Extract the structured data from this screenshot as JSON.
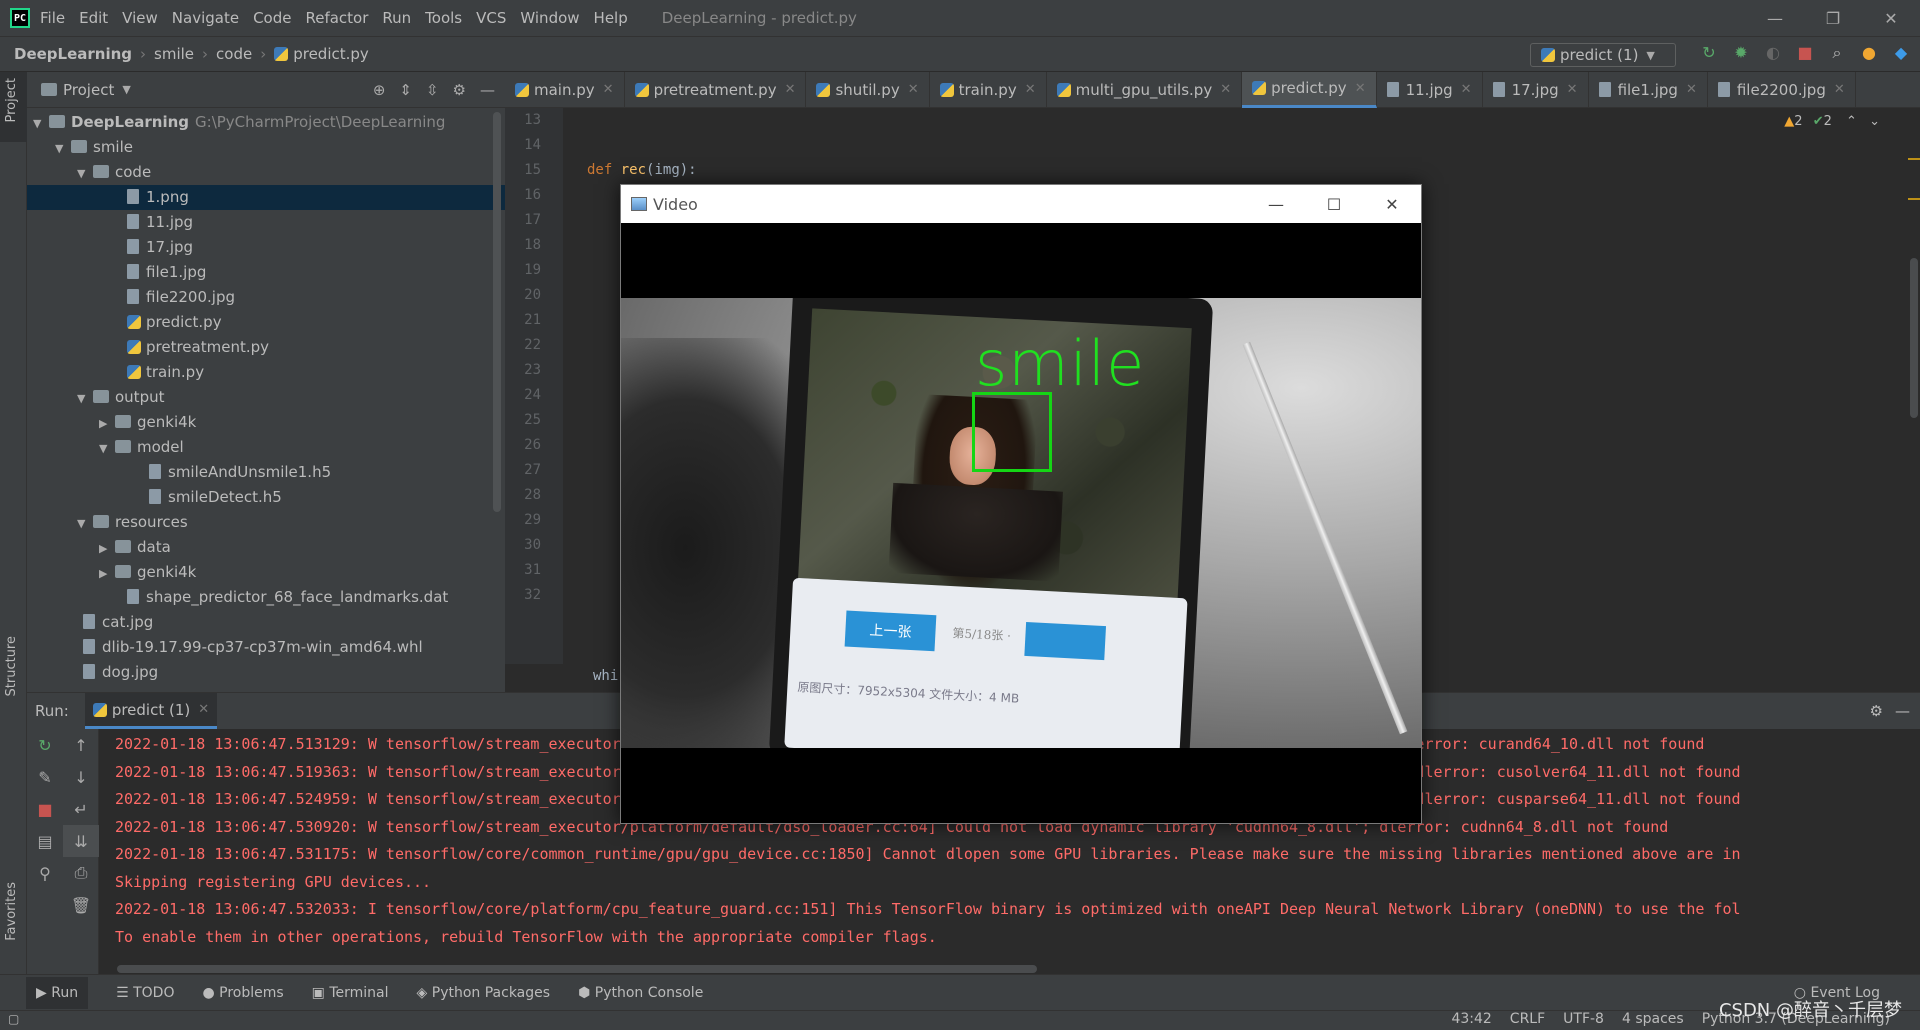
{
  "menubar": {
    "items": [
      "File",
      "Edit",
      "View",
      "Navigate",
      "Code",
      "Refactor",
      "Run",
      "Tools",
      "VCS",
      "Window",
      "Help"
    ],
    "window_title": "DeepLearning - predict.py"
  },
  "navbar": {
    "crumbs": [
      "DeepLearning",
      "smile",
      "code",
      "predict.py"
    ],
    "run_config": "predict (1)"
  },
  "project_panel": {
    "title": "Project",
    "tree": [
      {
        "label": "DeepLearning",
        "path": "G:\\PyCharmProject\\DeepLearning"
      },
      {
        "label": "smile"
      },
      {
        "label": "code"
      },
      {
        "label": "1.png"
      },
      {
        "label": "11.jpg"
      },
      {
        "label": "17.jpg"
      },
      {
        "label": "file1.jpg"
      },
      {
        "label": "file2200.jpg"
      },
      {
        "label": "predict.py"
      },
      {
        "label": "pretreatment.py"
      },
      {
        "label": "train.py"
      },
      {
        "label": "output"
      },
      {
        "label": "genki4k"
      },
      {
        "label": "model"
      },
      {
        "label": "smileAndUnsmile1.h5"
      },
      {
        "label": "smileDetect.h5"
      },
      {
        "label": "resources"
      },
      {
        "label": "data"
      },
      {
        "label": "genki4k"
      },
      {
        "label": "shape_predictor_68_face_landmarks.dat"
      },
      {
        "label": "cat.jpg"
      },
      {
        "label": "dlib-19.17.99-cp37-cp37m-win_amd64.whl"
      },
      {
        "label": "dog.jpg"
      }
    ]
  },
  "editor": {
    "tabs": [
      "main.py",
      "pretreatment.py",
      "shutil.py",
      "train.py",
      "multi_gpu_utils.py",
      "predict.py",
      "11.jpg",
      "17.jpg",
      "file1.jpg",
      "file2200.jpg"
    ],
    "active_tab": "predict.py",
    "line_numbers": [
      "13",
      "14",
      "15",
      "16",
      "17",
      "18",
      "19",
      "20",
      "21",
      "22",
      "23",
      "24",
      "25",
      "26",
      "27",
      "28",
      "29",
      "30",
      "31",
      "32"
    ],
    "code_line_15_kw": "def",
    "code_line_15_fn": "rec",
    "code_line_15_rest": "(img):",
    "bottom_fragment": "whi",
    "warnings": "2",
    "ok": "2"
  },
  "video_window": {
    "title": "Video",
    "label": "smile",
    "phone_prev": "上一张",
    "phone_page": "第5/18张 ·",
    "phone_dims": "原图尺寸：7952x5304  文件大小：4 MB"
  },
  "run_panel": {
    "label": "Run:",
    "tab": "predict (1)",
    "lines": [
      "2022-01-18 13:06:47.513129: W tensorflow/stream_executor/platform/default/dso_loader.cc:64] Could not load dynamic library 'curand64_10.dll'; dlerror: curand64_10.dll not found",
      "2022-01-18 13:06:47.519363: W tensorflow/stream_executor/platform/default/dso_loader.cc:64] Could not load dynamic library 'cusolver64_11.dll'; dlerror: cusolver64_11.dll not found",
      "2022-01-18 13:06:47.524959: W tensorflow/stream_executor/platform/default/dso_loader.cc:64] Could not load dynamic library 'cusparse64_11.dll'; dlerror: cusparse64_11.dll not found",
      "2022-01-18 13:06:47.530920: W tensorflow/stream_executor/platform/default/dso_loader.cc:64] Could not load dynamic library 'cudnn64_8.dll'; dlerror: cudnn64_8.dll not found",
      "2022-01-18 13:06:47.531175: W tensorflow/core/common_runtime/gpu/gpu_device.cc:1850] Cannot dlopen some GPU libraries. Please make sure the missing libraries mentioned above are in",
      "Skipping registering GPU devices...",
      "2022-01-18 13:06:47.532033: I tensorflow/core/platform/cpu_feature_guard.cc:151] This TensorFlow binary is optimized with oneAPI Deep Neural Network Library (oneDNN) to use the fol",
      "To enable them in other operations, rebuild TensorFlow with the appropriate compiler flags."
    ]
  },
  "bottom_tabs": [
    "Run",
    "TODO",
    "Problems",
    "Terminal",
    "Python Packages",
    "Python Console"
  ],
  "event_log": "Event Log",
  "statusbar": {
    "position": "43:42",
    "line_sep": "CRLF",
    "encoding": "UTF-8",
    "indent": "4 spaces",
    "interpreter": "Python 3.7 (DeepLearning)"
  },
  "watermark": "CSDN @醉音丶千层梦",
  "side_labels": {
    "project": "Project",
    "structure": "Structure",
    "favorites": "Favorites"
  }
}
